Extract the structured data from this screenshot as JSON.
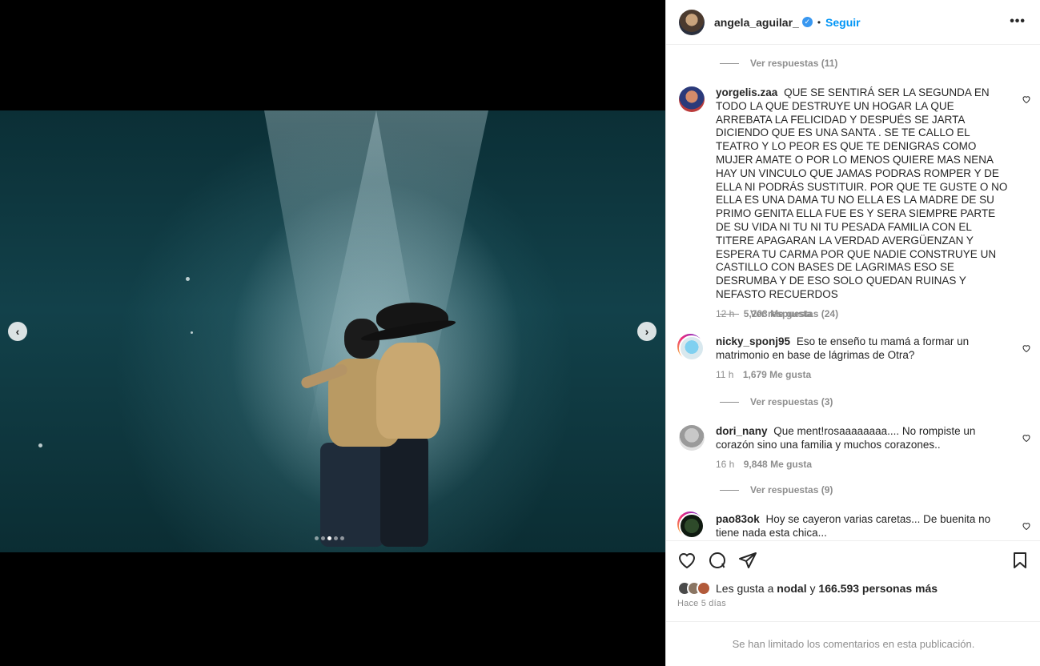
{
  "post": {
    "username": "angela_aguilar_",
    "follow_label": "Seguir",
    "separator": "•",
    "more_label": "•••"
  },
  "media": {
    "prev_label": "‹",
    "next_label": "›",
    "slide_count": 5,
    "active_slide": 3
  },
  "comments": {
    "replies_top": "Ver respuestas (11)",
    "items": [
      {
        "user": "yorgelis.zaa",
        "text": "QUE SE SENTIRÁ SER LA SEGUNDA EN TODO LA QUE DESTRUYE UN HOGAR LA QUE ARREBATA LA FELICIDAD Y DESPUÉS SE JARTA DICIENDO QUE ES UNA SANTA . SE TE CALLO EL TEATRO Y LO PEOR ES QUE TE DENIGRAS COMO MUJER AMATE O POR LO MENOS QUIERE MAS NENA HAY UN VINCULO QUE JAMAS PODRAS ROMPER Y DE ELLA NI PODRÁS SUSTITUIR. POR QUE TE GUSTE O NO ELLA ES UNA DAMA TU NO ELLA ES LA MADRE DE SU PRIMO GENITA ELLA FUE ES Y SERA SIEMPRE PARTE DE SU VIDA NI TU NI TU PESADA FAMILIA CON EL TITERE APAGARAN LA VERDAD AVERGÜENZAN Y ESPERA TU CARMA POR QUE NADIE CONSTRUYE UN CASTILLO CON BASES DE LAGRIMAS ESO SE DESRUMBA Y DE ESO SOLO QUEDAN RUINAS Y NEFASTO RECUERDOS",
        "time": "12 h",
        "likes": "5,203 Me gusta",
        "replies": "Ver respuestas (24)"
      },
      {
        "user": "nicky_sponj95",
        "text": "Eso te enseño tu mamá a formar un matrimonio en base de lágrimas de Otra?",
        "time": "11 h",
        "likes": "1,679 Me gusta",
        "replies": "Ver respuestas (3)"
      },
      {
        "user": "dori_nany",
        "text": "Que ment!rosaaaaaaaa.... No rompiste un corazón sino una familia y muchos corazones..",
        "time": "16 h",
        "likes": "9,848 Me gusta",
        "replies": "Ver respuestas (9)"
      },
      {
        "user": "pao83ok",
        "text": "Hoy se cayeron varias caretas... De buenita no tiene nada esta chica..."
      }
    ]
  },
  "likes": {
    "prefix": "Les gusta a",
    "first_user": "nodal",
    "connector": "y",
    "others": "166.593 personas más"
  },
  "posted_ago": "Hace 5 días",
  "limited_notice": "Se han limitado los comentarios en esta publicación."
}
